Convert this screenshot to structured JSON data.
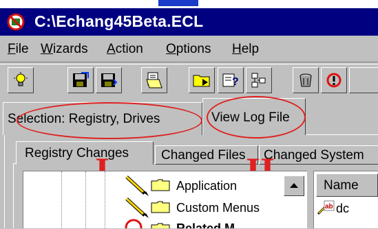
{
  "window": {
    "title": "C:\\Echang45Beta.ECL"
  },
  "menu": [
    {
      "label_u": "F",
      "label_rest": "ile"
    },
    {
      "label_u": "W",
      "label_rest": "izards"
    },
    {
      "label_u": "A",
      "label_rest": "ction"
    },
    {
      "label_u": "O",
      "label_rest": "ptions"
    },
    {
      "label_u": "H",
      "label_rest": "elp"
    }
  ],
  "toolbar": {
    "icons": [
      "lightbulb-icon",
      "save-export-icon",
      "save-icon",
      "open-document-icon",
      "folder-export-icon",
      "help-query-icon",
      "wizard-tree-icon",
      "trash-can-icon",
      "undo-stop-icon"
    ]
  },
  "upper_tabs": [
    {
      "label": "Selection: Registry, Drives"
    },
    {
      "label": "View Log File"
    }
  ],
  "lower_tabs": [
    {
      "label": "Registry Changes"
    },
    {
      "label": "Changed Files"
    },
    {
      "label": "Changed System"
    }
  ],
  "annotations": {
    "marker_one": "I",
    "marker_two": "II"
  },
  "tree": {
    "items": [
      {
        "label": "Application"
      },
      {
        "label": "Custom Menus"
      },
      {
        "label": "Related M..."
      }
    ]
  },
  "list": {
    "header": "Name",
    "first_item": "dc"
  },
  "colors": {
    "annotation_red": "#e02020",
    "titlebar": "#000080"
  }
}
